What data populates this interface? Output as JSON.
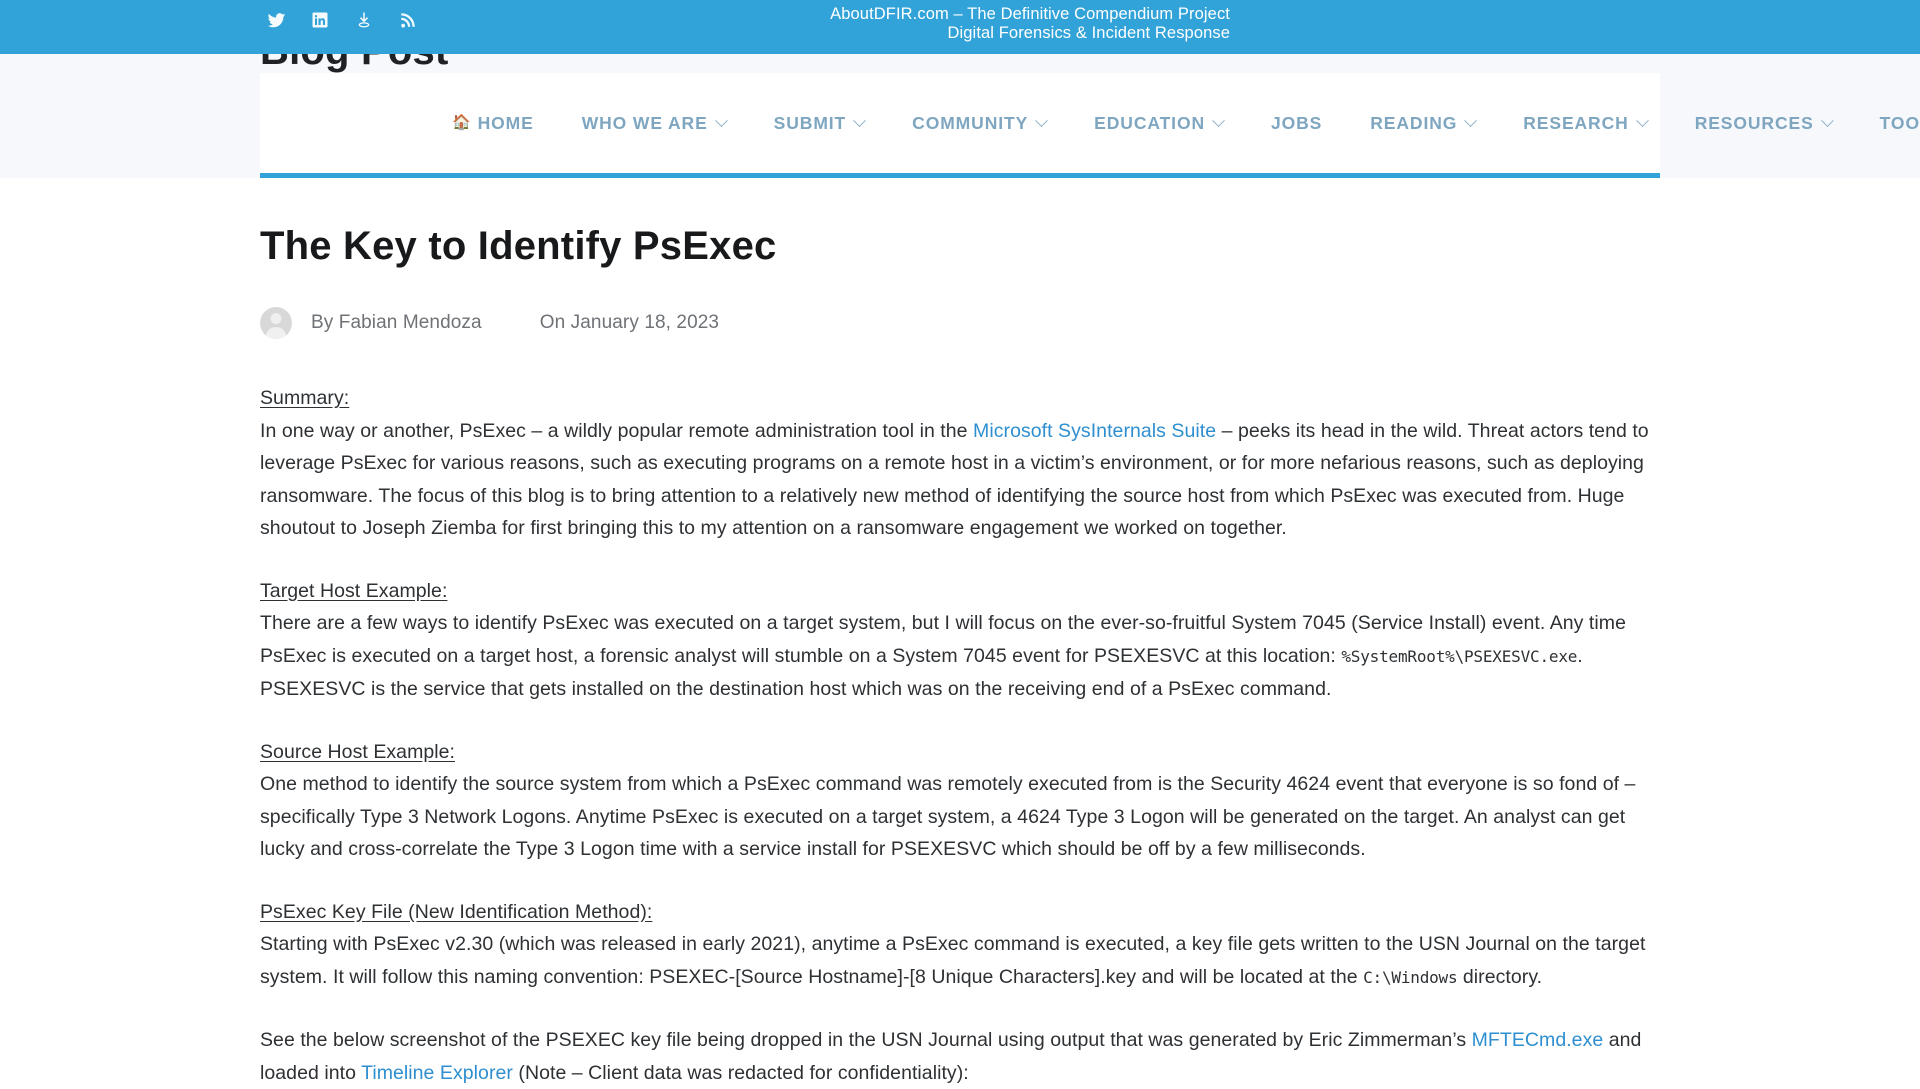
{
  "topbar": {
    "social_links": [
      {
        "name": "twitter-icon",
        "label": "Twitter"
      },
      {
        "name": "linkedin-icon",
        "label": "LinkedIn"
      },
      {
        "name": "download-icon",
        "label": "Download"
      },
      {
        "name": "rss-icon",
        "label": "RSS Feed"
      }
    ],
    "site_title": "AboutDFIR.com – The Definitive Compendium Project",
    "site_tagline": "Digital Forensics & Incident Response",
    "background_color": "#32a3d8"
  },
  "hero": {
    "heading": "Blog Post"
  },
  "nav": {
    "accent_color": "#32a3d8",
    "link_color": "#7fa6c0",
    "items": [
      {
        "label": "HOME",
        "has_caret": false,
        "has_home_icon": true
      },
      {
        "label": "WHO WE ARE",
        "has_caret": true,
        "has_home_icon": false
      },
      {
        "label": "SUBMIT",
        "has_caret": true,
        "has_home_icon": false
      },
      {
        "label": "COMMUNITY",
        "has_caret": true,
        "has_home_icon": false
      },
      {
        "label": "EDUCATION",
        "has_caret": true,
        "has_home_icon": false
      },
      {
        "label": "JOBS",
        "has_caret": false,
        "has_home_icon": false
      },
      {
        "label": "READING",
        "has_caret": true,
        "has_home_icon": false
      },
      {
        "label": "RESEARCH",
        "has_caret": true,
        "has_home_icon": false
      },
      {
        "label": "RESOURCES",
        "has_caret": true,
        "has_home_icon": false
      },
      {
        "label": "TOOLS & ARTIFACTS",
        "has_caret": true,
        "has_home_icon": false
      }
    ],
    "search_icon": "search-icon"
  },
  "post": {
    "title": "The Key to Identify PsExec",
    "author_prefix": "By",
    "author": "Fabian Mendoza",
    "date_prefix": "On",
    "date": "January 18, 2023",
    "sections": {
      "summary_heading": "Summary:",
      "summary_p1_a": "In one way or another, PsExec – a wildly popular remote administration tool in the ",
      "summary_link": "Microsoft SysInternals Suite",
      "summary_p1_b": " – peeks its head in the wild. Threat actors tend to leverage PsExec for various reasons, such as executing programs on a remote host in a victim’s environment, or for more nefarious reasons, such as deploying ransomware. The focus of this blog is to bring attention to a relatively new method of identifying the source host from which PsExec was executed from. Huge shoutout to Joseph Ziemba for first bringing this to my attention on a ransomware engagement we worked on together.",
      "target_heading": "Target Host Example:",
      "target_p_a": "There are a few ways to identify PsExec was executed on a target system, but I will focus on the ever-so-fruitful System 7045 (Service Install) event. Any time PsExec is executed on a target host, a forensic analyst will stumble on a System 7045 event for PSEXESVC at this location: ",
      "target_code": "%SystemRoot%\\PSEXESVC.exe",
      "target_p_b": ". PSEXESVC is the service that gets installed on the destination host which was on the receiving end of a PsExec command.",
      "source_heading": "Source Host Example:",
      "source_p": "One method to identify the source system from which a PsExec command was remotely executed from is the Security 4624 event that everyone is so fond of – specifically Type 3 Network Logons. Anytime PsExec is executed on a target system, a 4624 Type 3 Logon will be generated on the target. An analyst can get lucky and cross-correlate the Type 3 Logon time with a service install for PSEXESVC which should be off by a few milliseconds.",
      "keyfile_heading": "PsExec Key File (New Identification Method):",
      "keyfile_p_a": "Starting with PsExec v2.30 (which was released in early 2021), anytime a PsExec command is executed, a key file gets written to the USN Journal on the target system. It will follow this naming convention: PSEXEC-[Source Hostname]-[8 Unique Characters].key and will be located at the ",
      "keyfile_code": "C:\\Windows",
      "keyfile_p_b": " directory.",
      "screenshot_p_a": "See the below screenshot of the PSEXEC key file being dropped in the USN Journal using output that was generated by Eric Zimmerman’s ",
      "screenshot_link1": "MFTECmd.exe",
      "screenshot_p_b": " and loaded into ",
      "screenshot_link2": "Timeline Explorer",
      "screenshot_p_c": "(Note – Client data was redacted for confidentiality):"
    }
  }
}
